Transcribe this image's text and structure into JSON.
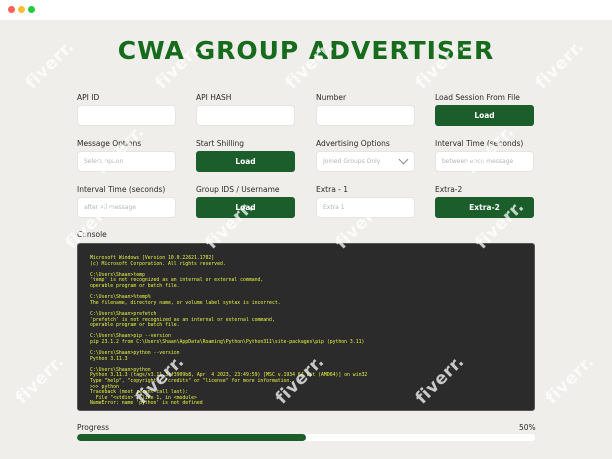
{
  "window": {
    "title": "CWA GROUP ADVERTISER"
  },
  "fields": {
    "api_id": {
      "label": "API ID",
      "value": ""
    },
    "api_hash": {
      "label": "API HASH",
      "value": ""
    },
    "number": {
      "label": "Number",
      "value": ""
    },
    "load_session": {
      "label": "Load Session From File",
      "button": "Load"
    },
    "message_options": {
      "label": "Message Options",
      "placeholder": "Select option"
    },
    "start_shilling": {
      "label": "Start Shilling",
      "button": "Load"
    },
    "advertising_options": {
      "label": "Advertising Options",
      "selected": "Joined Groups Only"
    },
    "interval_time_1": {
      "label": "Interval Time (seconds)",
      "placeholder": "between each message"
    },
    "interval_time_2": {
      "label": "Interval Time (seconds)",
      "placeholder": "after all message"
    },
    "group_ids": {
      "label": "Group IDS / Username",
      "button": "Load"
    },
    "extra_1": {
      "label": "Extra - 1",
      "placeholder": "Extra 1"
    },
    "extra_2": {
      "label": "Extra-2",
      "button": "Extra-2"
    }
  },
  "console": {
    "label": "Console",
    "lines": [
      "Microsoft Windows [Version 10.0.22621.1702]",
      "(c) Microsoft Corporation. All rights reserved.",
      "",
      "C:\\Users\\Shaan>temp",
      "'temp' is not recognized as an internal or external command,",
      "operable program or batch file.",
      "",
      "C:\\Users\\Shaan>%temp%",
      "The filename, directory name, or volume label syntax is incorrect.",
      "",
      "C:\\Users\\Shaan>prefetch",
      "'prefetch' is not recognized as an internal or external command,",
      "operable program or batch file.",
      "",
      "C:\\Users\\Shaan>pip --version",
      "pip 23.1.2 from C:\\Users\\Shaan\\AppData\\Roaming\\Python\\Python311\\site-packages\\pip (python 3.11)",
      "",
      "C:\\Users\\Shaan>python --version",
      "Python 3.11.3",
      "",
      "C:\\Users\\Shaan>python",
      "Python 3.11.3 (tags/v3.11.3:f3909b8, Apr  4 2023, 23:49:59) [MSC v.1934 64 bit (AMD64)] on win32",
      "Type \"help\", \"copyright\", \"credits\" or \"license\" for more information.",
      ">>> python",
      "Traceback (most recent call last):",
      "  File \"<stdin>\", line 1, in <module>",
      "NameError: name 'python' is not defined"
    ]
  },
  "progress": {
    "label": "Progress",
    "percent_text": "50%",
    "value": 0.5
  },
  "watermark": {
    "text": "fiverr."
  },
  "colors": {
    "accent": "#1b5e2b",
    "title": "#166b1d",
    "console_bg": "#2b2b2b",
    "console_text": "#e9f542",
    "background": "#efeeea"
  }
}
